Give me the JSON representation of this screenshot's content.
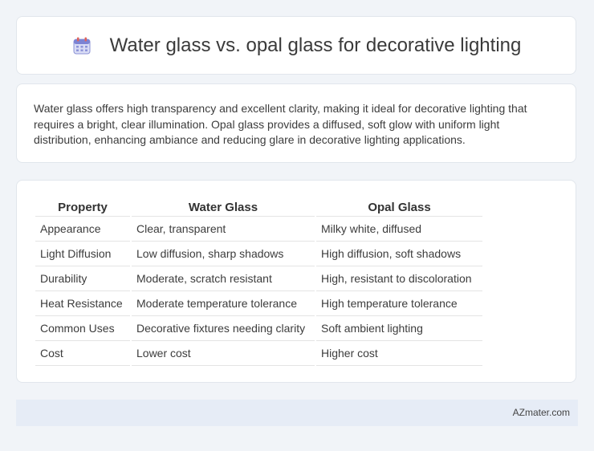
{
  "header": {
    "icon": "calendar-icon",
    "title": "Water glass vs. opal glass for decorative lighting"
  },
  "description": "Water glass offers high transparency and excellent clarity, making it ideal for decorative lighting that requires a bright, clear illumination. Opal glass provides a diffused, soft glow with uniform light distribution, enhancing ambiance and reducing glare in decorative lighting applications.",
  "table": {
    "headers": [
      "Property",
      "Water Glass",
      "Opal Glass"
    ],
    "rows": [
      [
        "Appearance",
        "Clear, transparent",
        "Milky white, diffused"
      ],
      [
        "Light Diffusion",
        "Low diffusion, sharp shadows",
        "High diffusion, soft shadows"
      ],
      [
        "Durability",
        "Moderate, scratch resistant",
        "High, resistant to discoloration"
      ],
      [
        "Heat Resistance",
        "Moderate temperature tolerance",
        "High temperature tolerance"
      ],
      [
        "Common Uses",
        "Decorative fixtures needing clarity",
        "Soft ambient lighting"
      ],
      [
        "Cost",
        "Lower cost",
        "Higher cost"
      ]
    ]
  },
  "footer": {
    "site": "AZmater.com"
  }
}
